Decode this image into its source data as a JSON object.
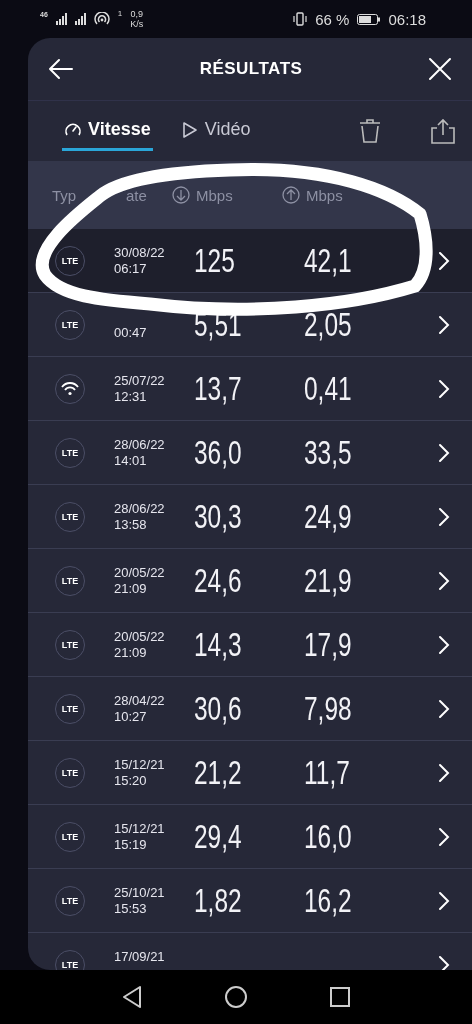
{
  "status_bar": {
    "network": "46",
    "hotspot_count": "1",
    "speed_value": "0,9",
    "speed_unit": "K/s",
    "battery": "66 %",
    "time": "06:18"
  },
  "header": {
    "title": "RÉSULTATS"
  },
  "tabs": [
    {
      "label": "Vitesse",
      "selected": true,
      "kind": "speed"
    },
    {
      "label": "Vidéo",
      "selected": false,
      "kind": "video"
    }
  ],
  "columns": [
    {
      "label": "Typ",
      "kind": "text"
    },
    {
      "label": "ate",
      "kind": "text"
    },
    {
      "label": "Mbps",
      "kind": "down"
    },
    {
      "label": "Mbps",
      "kind": "up"
    }
  ],
  "rows": [
    {
      "kind": "lte",
      "label": "LTE",
      "date": "30/08/22",
      "time": "06:17",
      "down": "125",
      "up": "42,1",
      "highlighted": true
    },
    {
      "kind": "lte",
      "label": "LTE",
      "time": "00:47",
      "down": "5,51",
      "up": "2,05",
      "highlighted": false
    },
    {
      "kind": "wifi",
      "date": "25/07/22",
      "time": "12:31",
      "down": "13,7",
      "up": "0,41",
      "highlighted": false
    },
    {
      "kind": "lte",
      "label": "LTE",
      "date": "28/06/22",
      "time": "14:01",
      "down": "36,0",
      "up": "33,5",
      "highlighted": false
    },
    {
      "kind": "lte",
      "label": "LTE",
      "date": "28/06/22",
      "time": "13:58",
      "down": "30,3",
      "up": "24,9",
      "highlighted": false
    },
    {
      "kind": "lte",
      "label": "LTE",
      "date": "20/05/22",
      "time": "21:09",
      "down": "24,6",
      "up": "21,9",
      "highlighted": false
    },
    {
      "kind": "lte",
      "label": "LTE",
      "date": "20/05/22",
      "time": "21:09",
      "down": "14,3",
      "up": "17,9",
      "highlighted": false
    },
    {
      "kind": "lte",
      "label": "LTE",
      "date": "28/04/22",
      "time": "10:27",
      "down": "30,6",
      "up": "7,98",
      "highlighted": false
    },
    {
      "kind": "lte",
      "label": "LTE",
      "date": "15/12/21",
      "time": "15:20",
      "down": "21,2",
      "up": "11,7",
      "highlighted": false
    },
    {
      "kind": "lte",
      "label": "LTE",
      "date": "15/12/21",
      "time": "15:19",
      "down": "29,4",
      "up": "16,0",
      "highlighted": false
    },
    {
      "kind": "lte",
      "label": "LTE",
      "date": "25/10/21",
      "time": "15:53",
      "down": "1,82",
      "up": "16,2",
      "highlighted": false
    },
    {
      "kind": "lte",
      "label": "LTE",
      "date": "17/09/21",
      "highlighted": false
    }
  ]
}
